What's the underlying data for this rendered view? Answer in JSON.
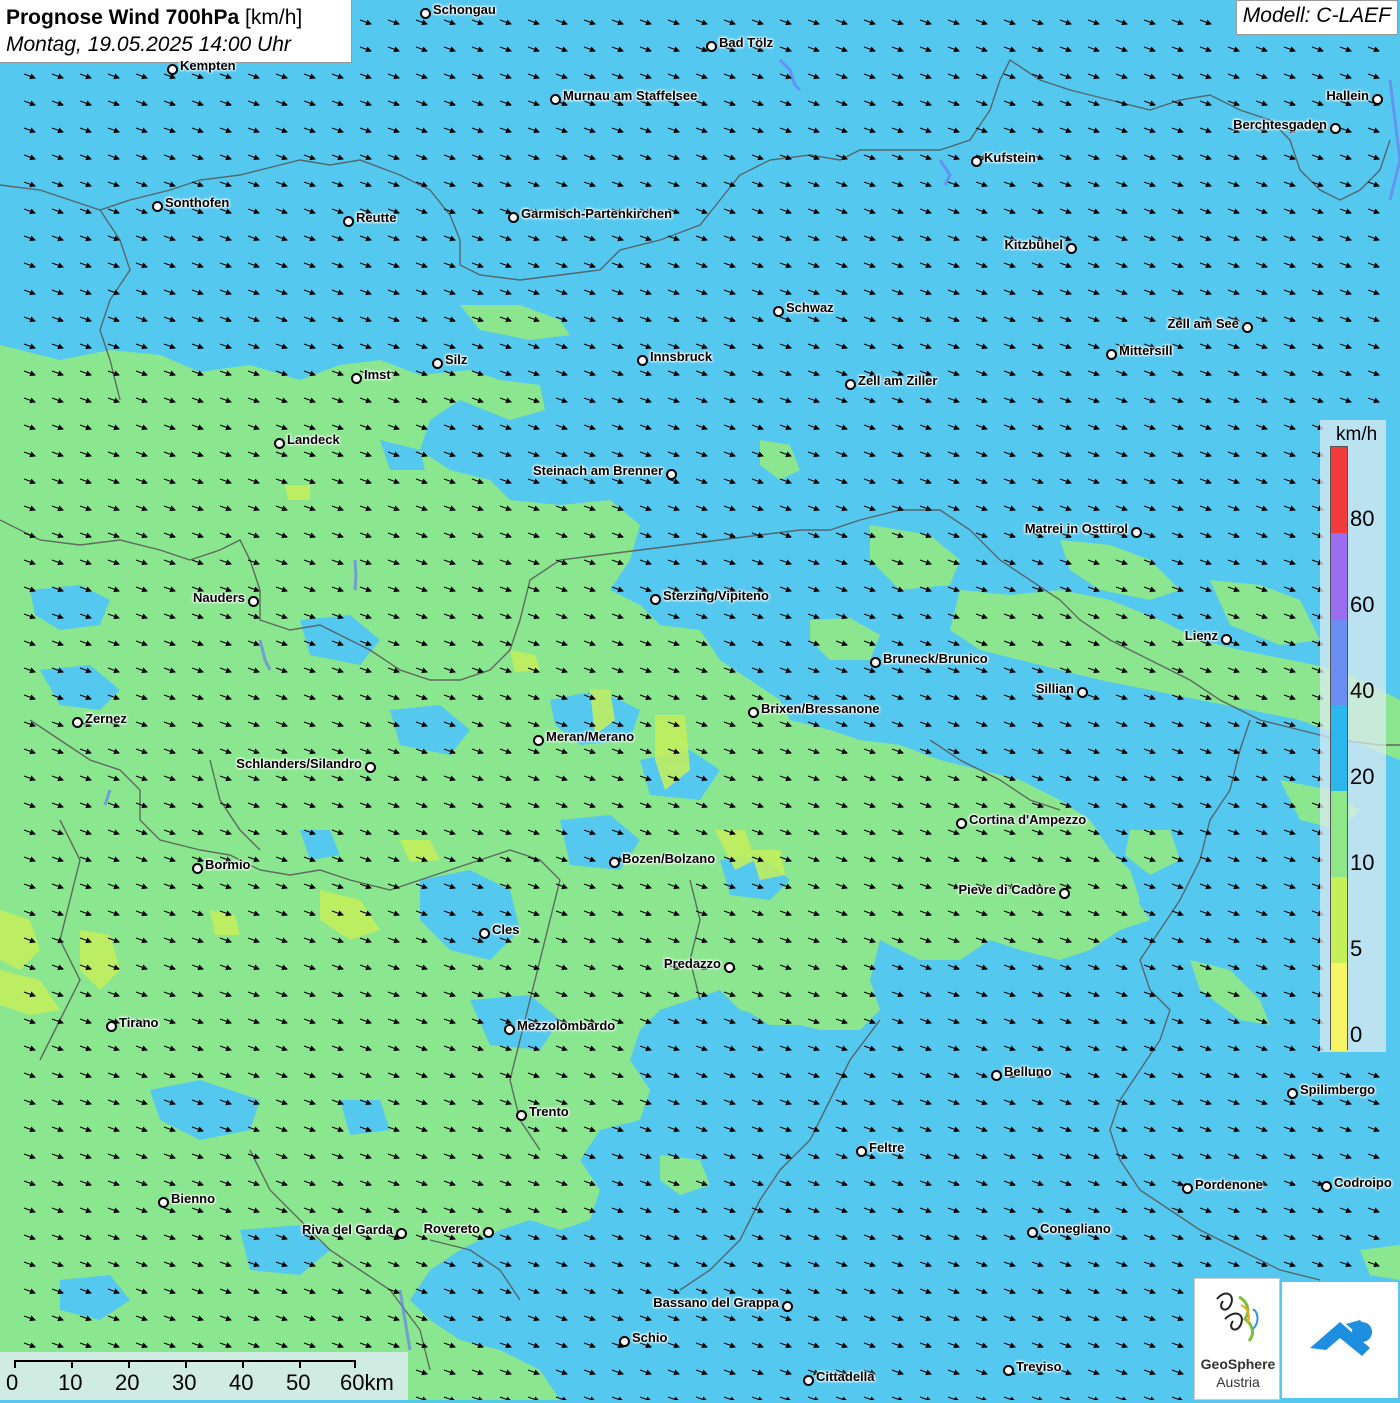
{
  "title": {
    "main": "Prognose Wind 700hPa",
    "unit": "[km/h]",
    "date": "Montag, 19.05.2025 14:00 Uhr"
  },
  "model": "Modell: C-LAEF",
  "legend": {
    "unit": "km/h",
    "labels": [
      "80",
      "60",
      "40",
      "20",
      "10",
      "5",
      "0"
    ],
    "colors": [
      "#f23b3b",
      "#9a6cf0",
      "#6a8ef0",
      "#2bb7ee",
      "#8ee88a",
      "#c6ef5a",
      "#f7f466"
    ]
  },
  "scale": {
    "labels": [
      "0",
      "10",
      "20",
      "30",
      "40",
      "50",
      "60km"
    ]
  },
  "logo": {
    "line1": "GeoSphere",
    "line2": "Austria"
  },
  "cities": [
    "Schongau",
    "Bad Tölz",
    "Kempten",
    "Murnau am Staffelsee",
    "Hallein",
    "Berchtesgaden",
    "Kufstein",
    "Sonthofen",
    "Reutte",
    "Garmisch-Partenkirchen",
    "Kitzbühel",
    "Schwaz",
    "Zell am See",
    "Silz",
    "Innsbruck",
    "Mittersill",
    "Imst",
    "Zell am Ziller",
    "Landeck",
    "Steinach am Brenner",
    "Matrei in Osttirol",
    "Nauders",
    "Sterzing/Vipiteno",
    "Lienz",
    "Bruneck/Brunico",
    "Sillian",
    "Brixen/Bressanone",
    "Zernez",
    "Meran/Merano",
    "Schlanders/Silandro",
    "Cortina d'Ampezzo",
    "Bozen/Bolzano",
    "Bormio",
    "Pieve di Cadore",
    "Cles",
    "Predazzo",
    "Tirano",
    "Mezzolombardo",
    "Belluno",
    "Spilimbergo",
    "Trento",
    "Feltre",
    "Pordenone",
    "Codroipo",
    "Bienno",
    "Riva del Garda",
    "Rovereto",
    "Conegliano",
    "Bassano del Grappa",
    "Schio",
    "Treviso",
    "Cittadella"
  ]
}
